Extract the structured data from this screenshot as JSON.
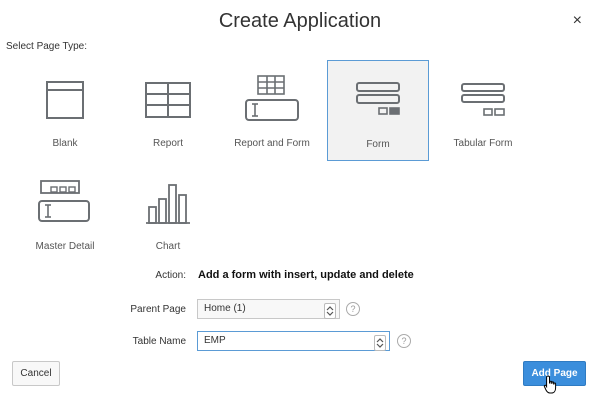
{
  "dialog": {
    "title": "Create Application",
    "close_glyph": "×"
  },
  "page_type": {
    "label": "Select Page Type:",
    "tiles": [
      {
        "label": "Blank",
        "icon": "blank-page-icon"
      },
      {
        "label": "Report",
        "icon": "report-grid-icon"
      },
      {
        "label": "Report and Form",
        "icon": "report-and-form-icon"
      },
      {
        "label": "Form",
        "icon": "form-icon",
        "selected": true
      },
      {
        "label": "Tabular Form",
        "icon": "tabular-form-icon"
      },
      {
        "label": "Master Detail",
        "icon": "master-detail-icon"
      },
      {
        "label": "Chart",
        "icon": "bar-chart-icon"
      }
    ]
  },
  "action": {
    "label": "Action:",
    "text": "Add a form with insert, update and delete"
  },
  "parent_page": {
    "label": "Parent Page",
    "value": "Home (1)",
    "help": "?"
  },
  "table_name": {
    "label": "Table Name",
    "value": "EMP",
    "help": "?"
  },
  "buttons": {
    "cancel": "Cancel",
    "add_page": "Add Page"
  },
  "colors": {
    "accent": "#3b8edc",
    "selected_border": "#5b9bd5",
    "icon_stroke": "#6b6f73"
  }
}
